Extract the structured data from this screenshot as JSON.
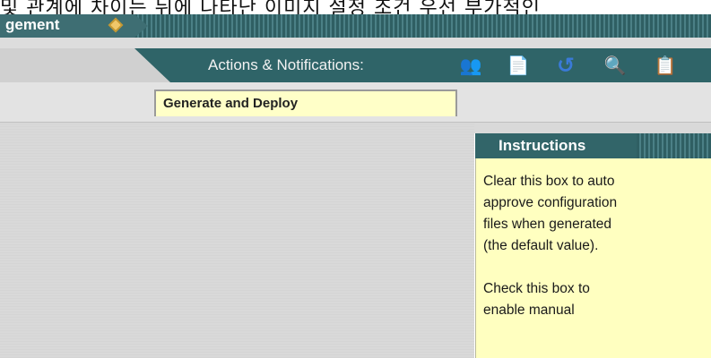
{
  "caption": {
    "text": "및 관계에 차이는 뒤에 나타난 이미지 설정 조건 우선 부가적인"
  },
  "title_bar": {
    "title": "gement"
  },
  "toolbar": {
    "label": "Actions & Notifications:",
    "icons": [
      {
        "name": "people-icon",
        "glyph": "👥",
        "color": "#c9a24a"
      },
      {
        "name": "copy-document-icon",
        "glyph": "📄",
        "color": "#ffffff"
      },
      {
        "name": "undo-arrow-icon",
        "glyph": "↺",
        "color": "#3a7ad8"
      },
      {
        "name": "search-users-icon",
        "glyph": "🔍",
        "color": "#9cc6e8"
      },
      {
        "name": "document-list-icon",
        "glyph": "📋",
        "color": "#dde6ee"
      }
    ]
  },
  "tab": {
    "label": "Generate and Deploy"
  },
  "instructions": {
    "title": "Instructions",
    "paragraphs": [
      "Clear this box to auto\napprove configuration\nfiles when generated\n(the default value).",
      "Check this box to\nenable manual"
    ]
  }
}
